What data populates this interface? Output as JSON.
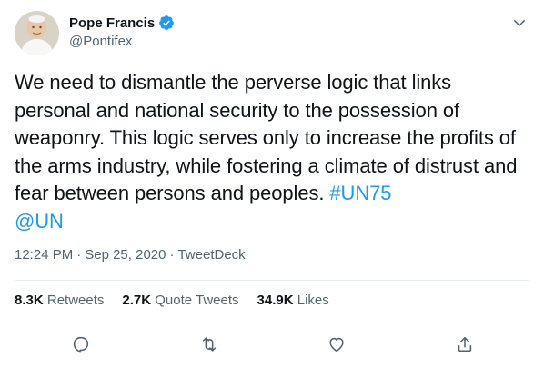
{
  "user": {
    "display_name": "Pope Francis",
    "handle": "@Pontifex",
    "verified_icon": "verified-badge-icon",
    "avatar": "avatar-photo"
  },
  "tweet": {
    "text_plain": "We need to dismantle the perverse logic that links personal and national security to the possession of weaponry. This logic serves only to increase the profits of the arms industry, while fostering a climate of distrust and fear between persons and peoples. ",
    "hashtag": "#UN75",
    "mention": "@UN"
  },
  "meta": {
    "time": "12:24 PM",
    "separator1": "·",
    "date": "Sep 25, 2020",
    "separator2": "·",
    "source": "TweetDeck"
  },
  "stats": {
    "retweets_count": "8.3K",
    "retweets_label": "Retweets",
    "quotes_count": "2.7K",
    "quotes_label": "Quote Tweets",
    "likes_count": "34.9K",
    "likes_label": "Likes"
  },
  "actions": {
    "reply": "reply-icon",
    "retweet": "retweet-icon",
    "like": "like-icon",
    "share": "share-icon"
  },
  "colors": {
    "link": "#1d9bf0",
    "text": "#0f1419",
    "muted": "#536471",
    "divider": "#e6ecf0"
  }
}
